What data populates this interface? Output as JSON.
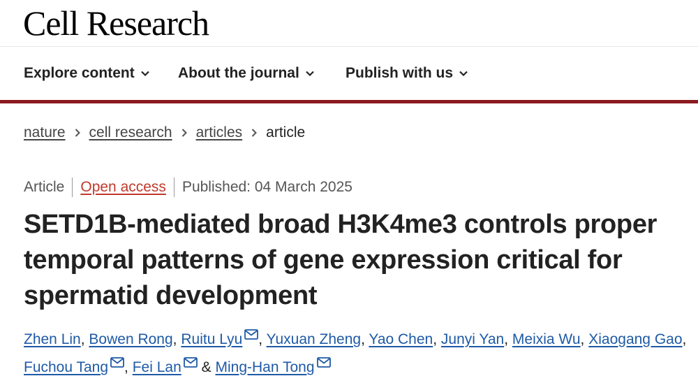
{
  "header": {
    "logo": "Cell Research"
  },
  "nav": {
    "items": [
      {
        "label": "Explore content"
      },
      {
        "label": "About the journal"
      },
      {
        "label": "Publish with us"
      }
    ]
  },
  "breadcrumb": {
    "links": [
      "nature",
      "cell research",
      "articles"
    ],
    "current": "article"
  },
  "article_meta": {
    "type": "Article",
    "access": "Open access",
    "published": "Published: 04 March 2025"
  },
  "article": {
    "title_lines": [
      "SETD1B-mediated broad H3K4me3 controls proper",
      "temporal patterns of gene expression critical for",
      "spermatid development"
    ]
  },
  "authors": {
    "line1": [
      "Zhen Lin",
      "Bowen Rong",
      "Ruitu Lyu",
      "Yuxuan Zheng",
      "Yao Chen",
      "Junyi Yan",
      "Meixia Wu",
      "Xiaogang Gao"
    ],
    "line2": [
      "Fuchou Tang",
      "Fei Lan",
      "Ming-Han Tong"
    ],
    "comma": ",",
    "ampersand": "&"
  },
  "colors": {
    "brand_rule": "#8b1a1f",
    "link": "#1f5aa6",
    "open_access": "#c0392b"
  },
  "icons": {
    "nav_chevron": "chevron-down-icon",
    "breadcrumb_separator": "chevron-right-icon",
    "corresponding_author": "mail-icon"
  }
}
